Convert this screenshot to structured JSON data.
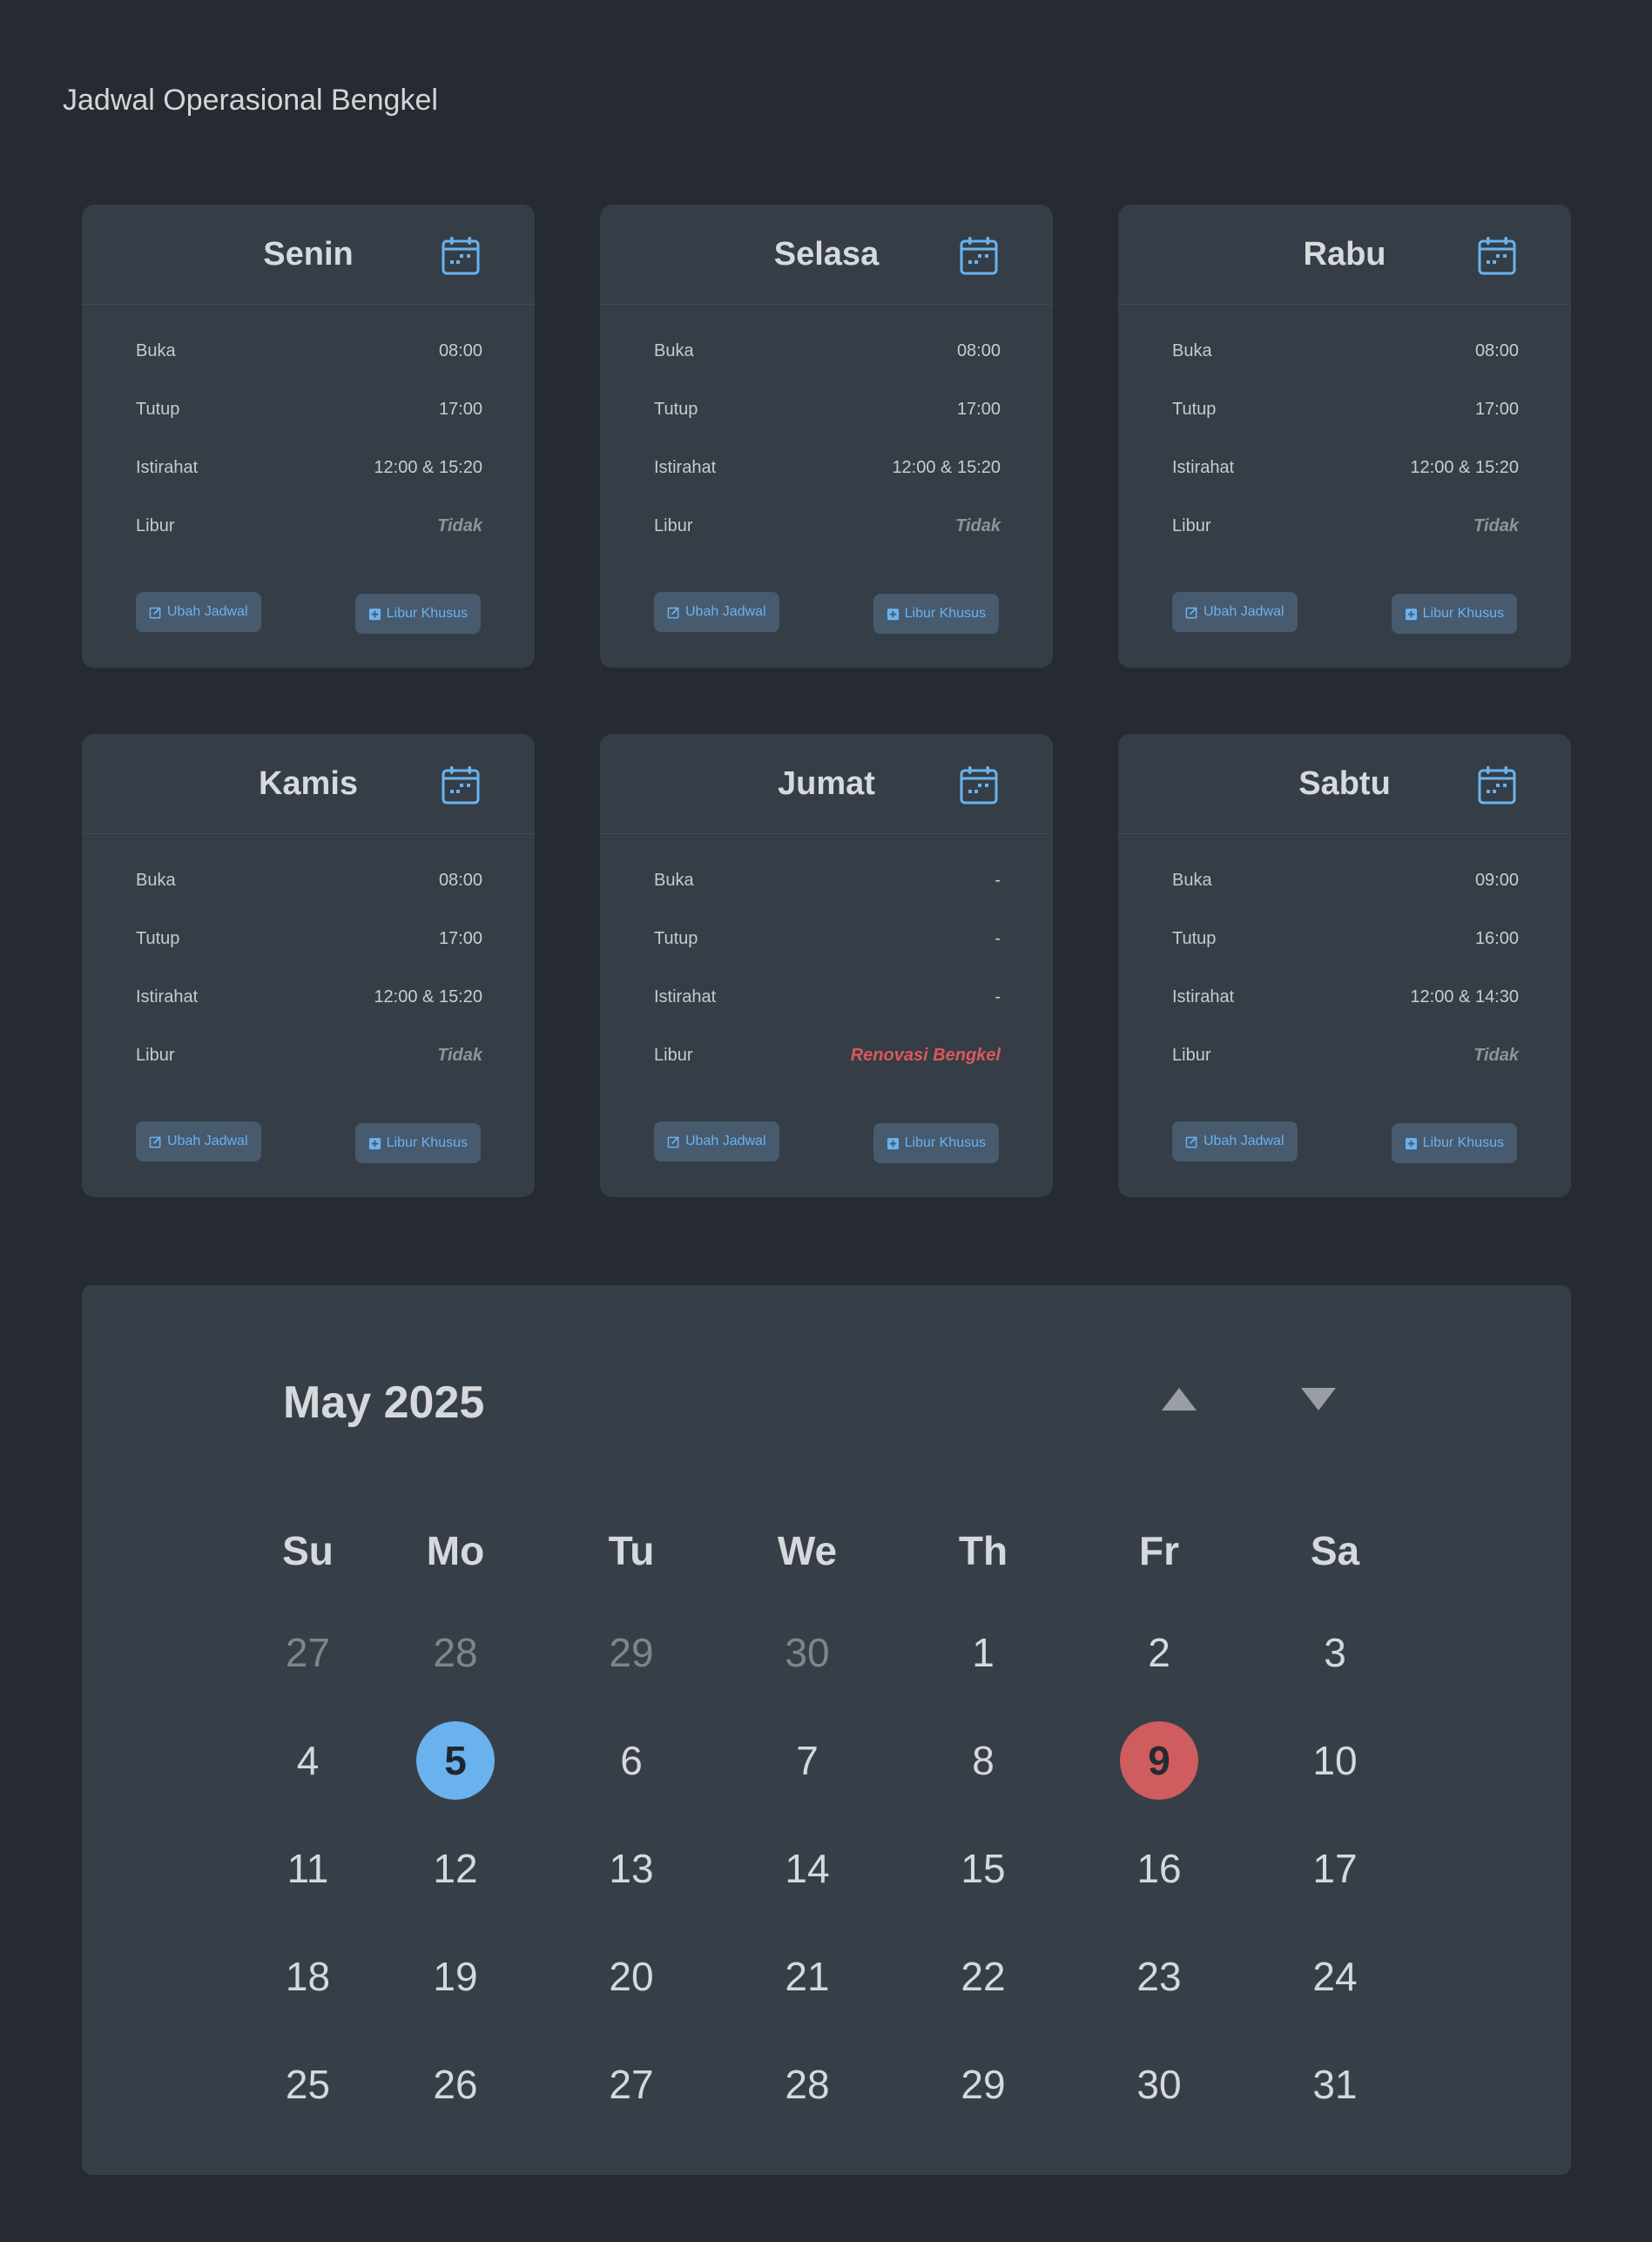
{
  "page": {
    "title": "Jadwal Operasional Bengkel"
  },
  "labels": {
    "open": "Buka",
    "close": "Tutup",
    "break": "Istirahat",
    "holiday": "Libur",
    "edit_button": "Ubah Jadwal",
    "special_holiday_button": "Libur Khusus"
  },
  "days": [
    {
      "name": "Senin",
      "open": "08:00",
      "close": "17:00",
      "break": "12:00 & 15:20",
      "holiday": "Tidak",
      "is_holiday": false
    },
    {
      "name": "Selasa",
      "open": "08:00",
      "close": "17:00",
      "break": "12:00 & 15:20",
      "holiday": "Tidak",
      "is_holiday": false
    },
    {
      "name": "Rabu",
      "open": "08:00",
      "close": "17:00",
      "break": "12:00 & 15:20",
      "holiday": "Tidak",
      "is_holiday": false
    },
    {
      "name": "Kamis",
      "open": "08:00",
      "close": "17:00",
      "break": "12:00 & 15:20",
      "holiday": "Tidak",
      "is_holiday": false
    },
    {
      "name": "Jumat",
      "open": "-",
      "close": "-",
      "break": "-",
      "holiday": "Renovasi Bengkel",
      "is_holiday": true
    },
    {
      "name": "Sabtu",
      "open": "09:00",
      "close": "16:00",
      "break": "12:00 & 14:30",
      "holiday": "Tidak",
      "is_holiday": false
    }
  ],
  "calendar": {
    "title": "May 2025",
    "weekdays": [
      "Su",
      "Mo",
      "Tu",
      "We",
      "Th",
      "Fr",
      "Sa"
    ],
    "weeks": [
      [
        {
          "d": "27",
          "muted": true
        },
        {
          "d": "28",
          "muted": true
        },
        {
          "d": "29",
          "muted": true
        },
        {
          "d": "30",
          "muted": true
        },
        {
          "d": "1"
        },
        {
          "d": "2"
        },
        {
          "d": "3"
        }
      ],
      [
        {
          "d": "4"
        },
        {
          "d": "5",
          "state": "today"
        },
        {
          "d": "6"
        },
        {
          "d": "7"
        },
        {
          "d": "8"
        },
        {
          "d": "9",
          "state": "holiday"
        },
        {
          "d": "10"
        }
      ],
      [
        {
          "d": "11"
        },
        {
          "d": "12"
        },
        {
          "d": "13"
        },
        {
          "d": "14"
        },
        {
          "d": "15"
        },
        {
          "d": "16"
        },
        {
          "d": "17"
        }
      ],
      [
        {
          "d": "18"
        },
        {
          "d": "19"
        },
        {
          "d": "20"
        },
        {
          "d": "21"
        },
        {
          "d": "22"
        },
        {
          "d": "23"
        },
        {
          "d": "24"
        }
      ],
      [
        {
          "d": "25"
        },
        {
          "d": "26"
        },
        {
          "d": "27"
        },
        {
          "d": "28"
        },
        {
          "d": "29"
        },
        {
          "d": "30"
        },
        {
          "d": "31"
        }
      ]
    ]
  },
  "colors": {
    "background": "#262a31",
    "card": "#353d46",
    "accent": "#6ab2ee",
    "danger": "#d9595b"
  },
  "icons": {
    "card_header": "calendar-icon",
    "edit": "edit-icon",
    "add": "plus-square-icon",
    "prev": "caret-up-icon",
    "next": "caret-down-icon"
  }
}
